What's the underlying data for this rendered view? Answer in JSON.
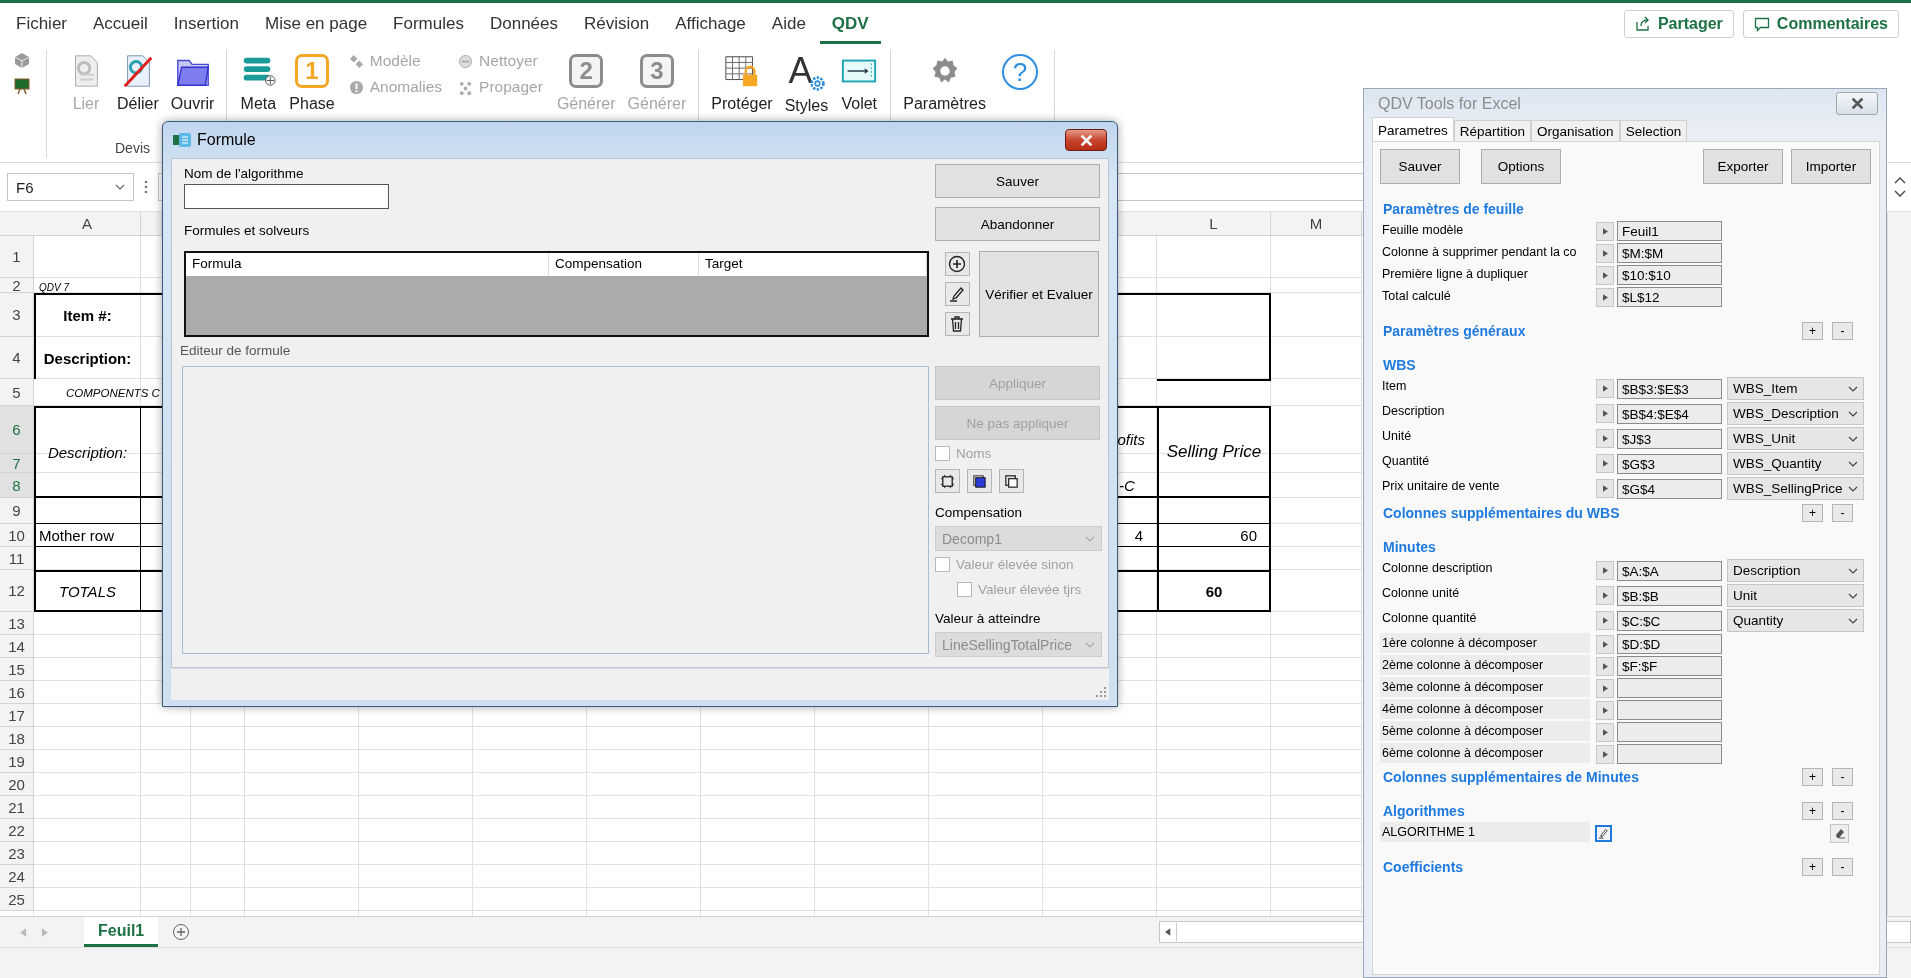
{
  "ribbon_tabs": [
    {
      "label": "Fichier",
      "selected": false
    },
    {
      "label": "Accueil",
      "selected": false
    },
    {
      "label": "Insertion",
      "selected": false
    },
    {
      "label": "Mise en page",
      "selected": false
    },
    {
      "label": "Formules",
      "selected": false
    },
    {
      "label": "Données",
      "selected": false
    },
    {
      "label": "Révision",
      "selected": false
    },
    {
      "label": "Affichage",
      "selected": false
    },
    {
      "label": "Aide",
      "selected": false
    },
    {
      "label": "QDV",
      "selected": true
    }
  ],
  "header_buttons": [
    "Partager",
    "Commentaires"
  ],
  "ribbon_groups": [
    {
      "label": "Devis",
      "items": [
        {
          "kind": "large",
          "label": "Lier",
          "disabled": true
        },
        {
          "kind": "large",
          "label": "Délier",
          "disabled": false
        },
        {
          "kind": "large",
          "label": "Ouvrir",
          "disabled": false
        }
      ]
    },
    {
      "items": [
        {
          "kind": "large",
          "label": "Meta",
          "disabled": false
        },
        {
          "kind": "large",
          "label": "Phase",
          "badge": "1",
          "disabled": false
        },
        {
          "kind": "stack",
          "items": [
            {
              "label": "Modèle",
              "disabled": true
            },
            {
              "label": "Anomalies",
              "disabled": true
            }
          ]
        },
        {
          "kind": "stack",
          "items": [
            {
              "label": "Nettoyer",
              "disabled": true
            },
            {
              "label": "Propager",
              "disabled": true
            }
          ]
        },
        {
          "kind": "large",
          "label": "Générer",
          "badge": "2",
          "disabled": true
        },
        {
          "kind": "large",
          "label": "Générer",
          "badge": "3",
          "disabled": true
        }
      ]
    },
    {
      "items": [
        {
          "kind": "large",
          "label": "Protéger",
          "disabled": false
        },
        {
          "kind": "large",
          "label": "Styles",
          "glyph": "A",
          "disabled": false
        },
        {
          "kind": "large",
          "label": "Volet",
          "disabled": false
        }
      ]
    },
    {
      "items": [
        {
          "kind": "large",
          "label": "Paramètres",
          "disabled": false
        },
        {
          "kind": "help",
          "glyph": "?"
        }
      ]
    }
  ],
  "name_box": "F6",
  "columns": [
    "A",
    "L",
    "M"
  ],
  "rows": [
    {
      "label": "1",
      "selected": false
    },
    {
      "label": "2",
      "selected": false
    },
    {
      "label": "3",
      "selected": false
    },
    {
      "label": "4",
      "selected": false
    },
    {
      "label": "5",
      "selected": false
    },
    {
      "label": "6",
      "selected": true
    },
    {
      "label": "7",
      "selected": true
    },
    {
      "label": "8",
      "selected": true
    },
    {
      "label": "9",
      "selected": false
    },
    {
      "label": "10",
      "selected": false
    },
    {
      "label": "11",
      "selected": false
    },
    {
      "label": "12",
      "selected": false
    },
    {
      "label": "13",
      "selected": false
    },
    {
      "label": "14",
      "selected": false
    },
    {
      "label": "15",
      "selected": false
    },
    {
      "label": "16",
      "selected": false
    },
    {
      "label": "17",
      "selected": false
    },
    {
      "label": "18",
      "selected": false
    },
    {
      "label": "19",
      "selected": false
    },
    {
      "label": "20",
      "selected": false
    },
    {
      "label": "21",
      "selected": false
    },
    {
      "label": "22",
      "selected": false
    },
    {
      "label": "23",
      "selected": false
    },
    {
      "label": "24",
      "selected": false
    },
    {
      "label": "25",
      "selected": false
    }
  ],
  "cells": [
    "QDV 7",
    "Item #:",
    "Description:",
    "COMPONENTS C",
    "Description:",
    "ofits",
    "Selling Price",
    "-C",
    "Mother row",
    "4",
    "60",
    "TOTALS",
    "60"
  ],
  "sheet_tabs": [
    {
      "label": "Feuil1",
      "selected": true
    }
  ],
  "dialog": {
    "title": "Formule",
    "name_label": "Nom de l'algorithme",
    "formulas_label": "Formules et solveurs",
    "table_columns": [
      "Formula",
      "Compensation",
      "Target"
    ],
    "editor_label": "Editeur de formule",
    "save_button": {
      "label": "Sauver",
      "disabled": false
    },
    "cancel_button": {
      "label": "Abandonner",
      "disabled": false
    },
    "evaluate_button": {
      "label": "Vérifier et Evaluer",
      "disabled": false
    },
    "apply_button": {
      "label": "Appliquer",
      "disabled": true
    },
    "discard_button": {
      "label": "Ne pas appliquer",
      "disabled": true
    },
    "names_checkbox": {
      "label": "Noms",
      "checked": false,
      "disabled": true
    },
    "compensation_label": "Compensation",
    "compensation_select": {
      "value": "Decomp1",
      "disabled": true
    },
    "checkboxes": [
      {
        "label": "Valeur élevée sinon",
        "checked": false,
        "disabled": true
      },
      {
        "label": "Valeur élevée tjrs",
        "checked": false,
        "disabled": true
      }
    ],
    "target_label": "Valeur à atteindre",
    "target_select": {
      "value": "LineSellingTotalPrice",
      "disabled": true
    }
  },
  "panel": {
    "title": "QDV Tools for Excel",
    "tabs": [
      {
        "label": "Parametres",
        "selected": true
      },
      {
        "label": "Répartition",
        "selected": false
      },
      {
        "label": "Organisation",
        "selected": false
      },
      {
        "label": "Selection",
        "selected": false
      }
    ],
    "buttons": [
      "Sauver",
      "Options",
      "Exporter",
      "Importer"
    ],
    "sections": [
      {
        "title": "Paramètres de feuille",
        "rows": [
          {
            "kind": "field",
            "label": "Feuille modèle",
            "value": "Feuil1"
          },
          {
            "kind": "field",
            "label": "Colonne à supprimer pendant la co",
            "value": "$M:$M"
          },
          {
            "kind": "field",
            "label": "Première ligne à dupliquer",
            "value": "$10:$10"
          },
          {
            "kind": "field",
            "label": "Total calculé",
            "value": "$L$12"
          }
        ]
      },
      {
        "title": "Paramètres généraux",
        "controls": [
          "+",
          "-"
        ]
      },
      {
        "title": "WBS",
        "rows": [
          {
            "kind": "select",
            "label": "Item",
            "value": "$B$3:$E$3",
            "option": "WBS_Item"
          },
          {
            "kind": "select",
            "label": "Description",
            "value": "$B$4:$E$4",
            "option": "WBS_Description"
          },
          {
            "kind": "select",
            "label": "Unité",
            "value": "$J$3",
            "option": "WBS_Unit"
          },
          {
            "kind": "select",
            "label": "Quantité",
            "value": "$G$3",
            "option": "WBS_Quantity"
          },
          {
            "kind": "select",
            "label": "Prix unitaire de vente",
            "value": "$G$4",
            "option": "WBS_SellingPrice"
          }
        ]
      },
      {
        "title": "Colonnes supplémentaires du WBS",
        "controls": [
          "+",
          "-"
        ]
      },
      {
        "title": "Minutes",
        "rows": [
          {
            "kind": "select",
            "label": "Colonne description",
            "value": "$A:$A",
            "option": "Description"
          },
          {
            "kind": "select",
            "label": "Colonne unité",
            "value": "$B:$B",
            "option": "Unit"
          },
          {
            "kind": "select",
            "label": "Colonne quantité",
            "value": "$C:$C",
            "option": "Quantity"
          },
          {
            "kind": "decompose",
            "label": "1ère colonne à décomposer",
            "value": "$D:$D"
          },
          {
            "kind": "decompose",
            "label": "2ème colonne à décomposer",
            "value": "$F:$F"
          },
          {
            "kind": "decompose",
            "label": "3ème colonne à décomposer"
          },
          {
            "kind": "decompose",
            "label": "4ème colonne à décomposer"
          },
          {
            "kind": "decompose",
            "label": "5ème colonne à décomposer"
          },
          {
            "kind": "decompose",
            "label": "6ème colonne à décomposer"
          }
        ]
      },
      {
        "title": "Colonnes supplémentaires de Minutes",
        "controls": [
          "+",
          "-"
        ]
      },
      {
        "title": "Algorithmes",
        "controls": [
          "+",
          "-"
        ],
        "rows": [
          {
            "kind": "algorithm",
            "label": "ALGORITHME 1"
          }
        ]
      },
      {
        "title": "Coefficients",
        "controls": [
          "+",
          "-"
        ]
      }
    ]
  }
}
